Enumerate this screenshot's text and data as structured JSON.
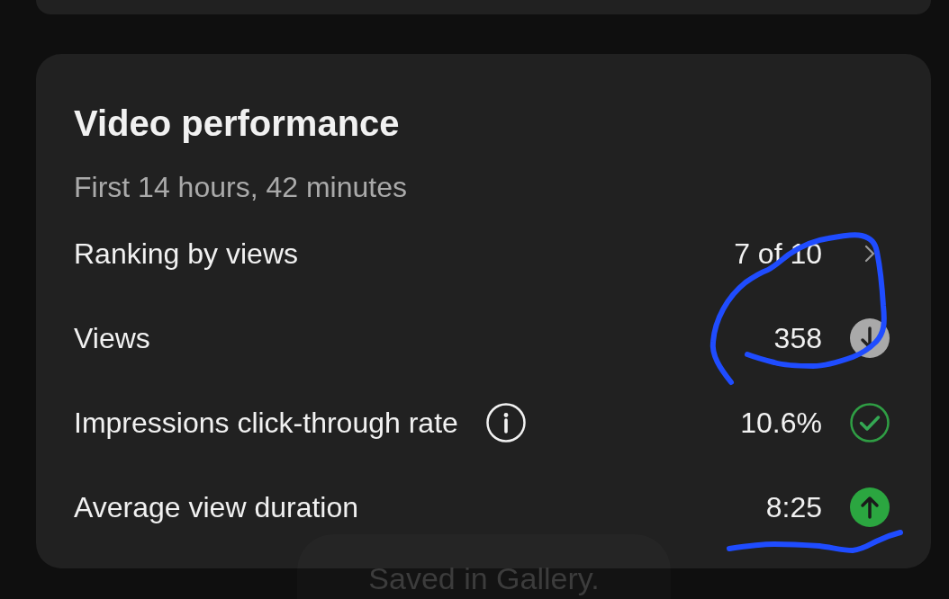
{
  "card": {
    "title": "Video performance",
    "subtitle": "First 14 hours, 42 minutes",
    "metrics": [
      {
        "label": "Ranking by views",
        "info": false,
        "value": "7 of 10",
        "kind": "link"
      },
      {
        "label": "Views",
        "info": false,
        "value": "358",
        "kind": "down"
      },
      {
        "label": "Impressions click-through rate",
        "info": true,
        "value": "10.6%",
        "kind": "check"
      },
      {
        "label": "Average view duration",
        "info": false,
        "value": "8:25",
        "kind": "up"
      }
    ]
  },
  "toast": {
    "text": "Saved in Gallery."
  }
}
